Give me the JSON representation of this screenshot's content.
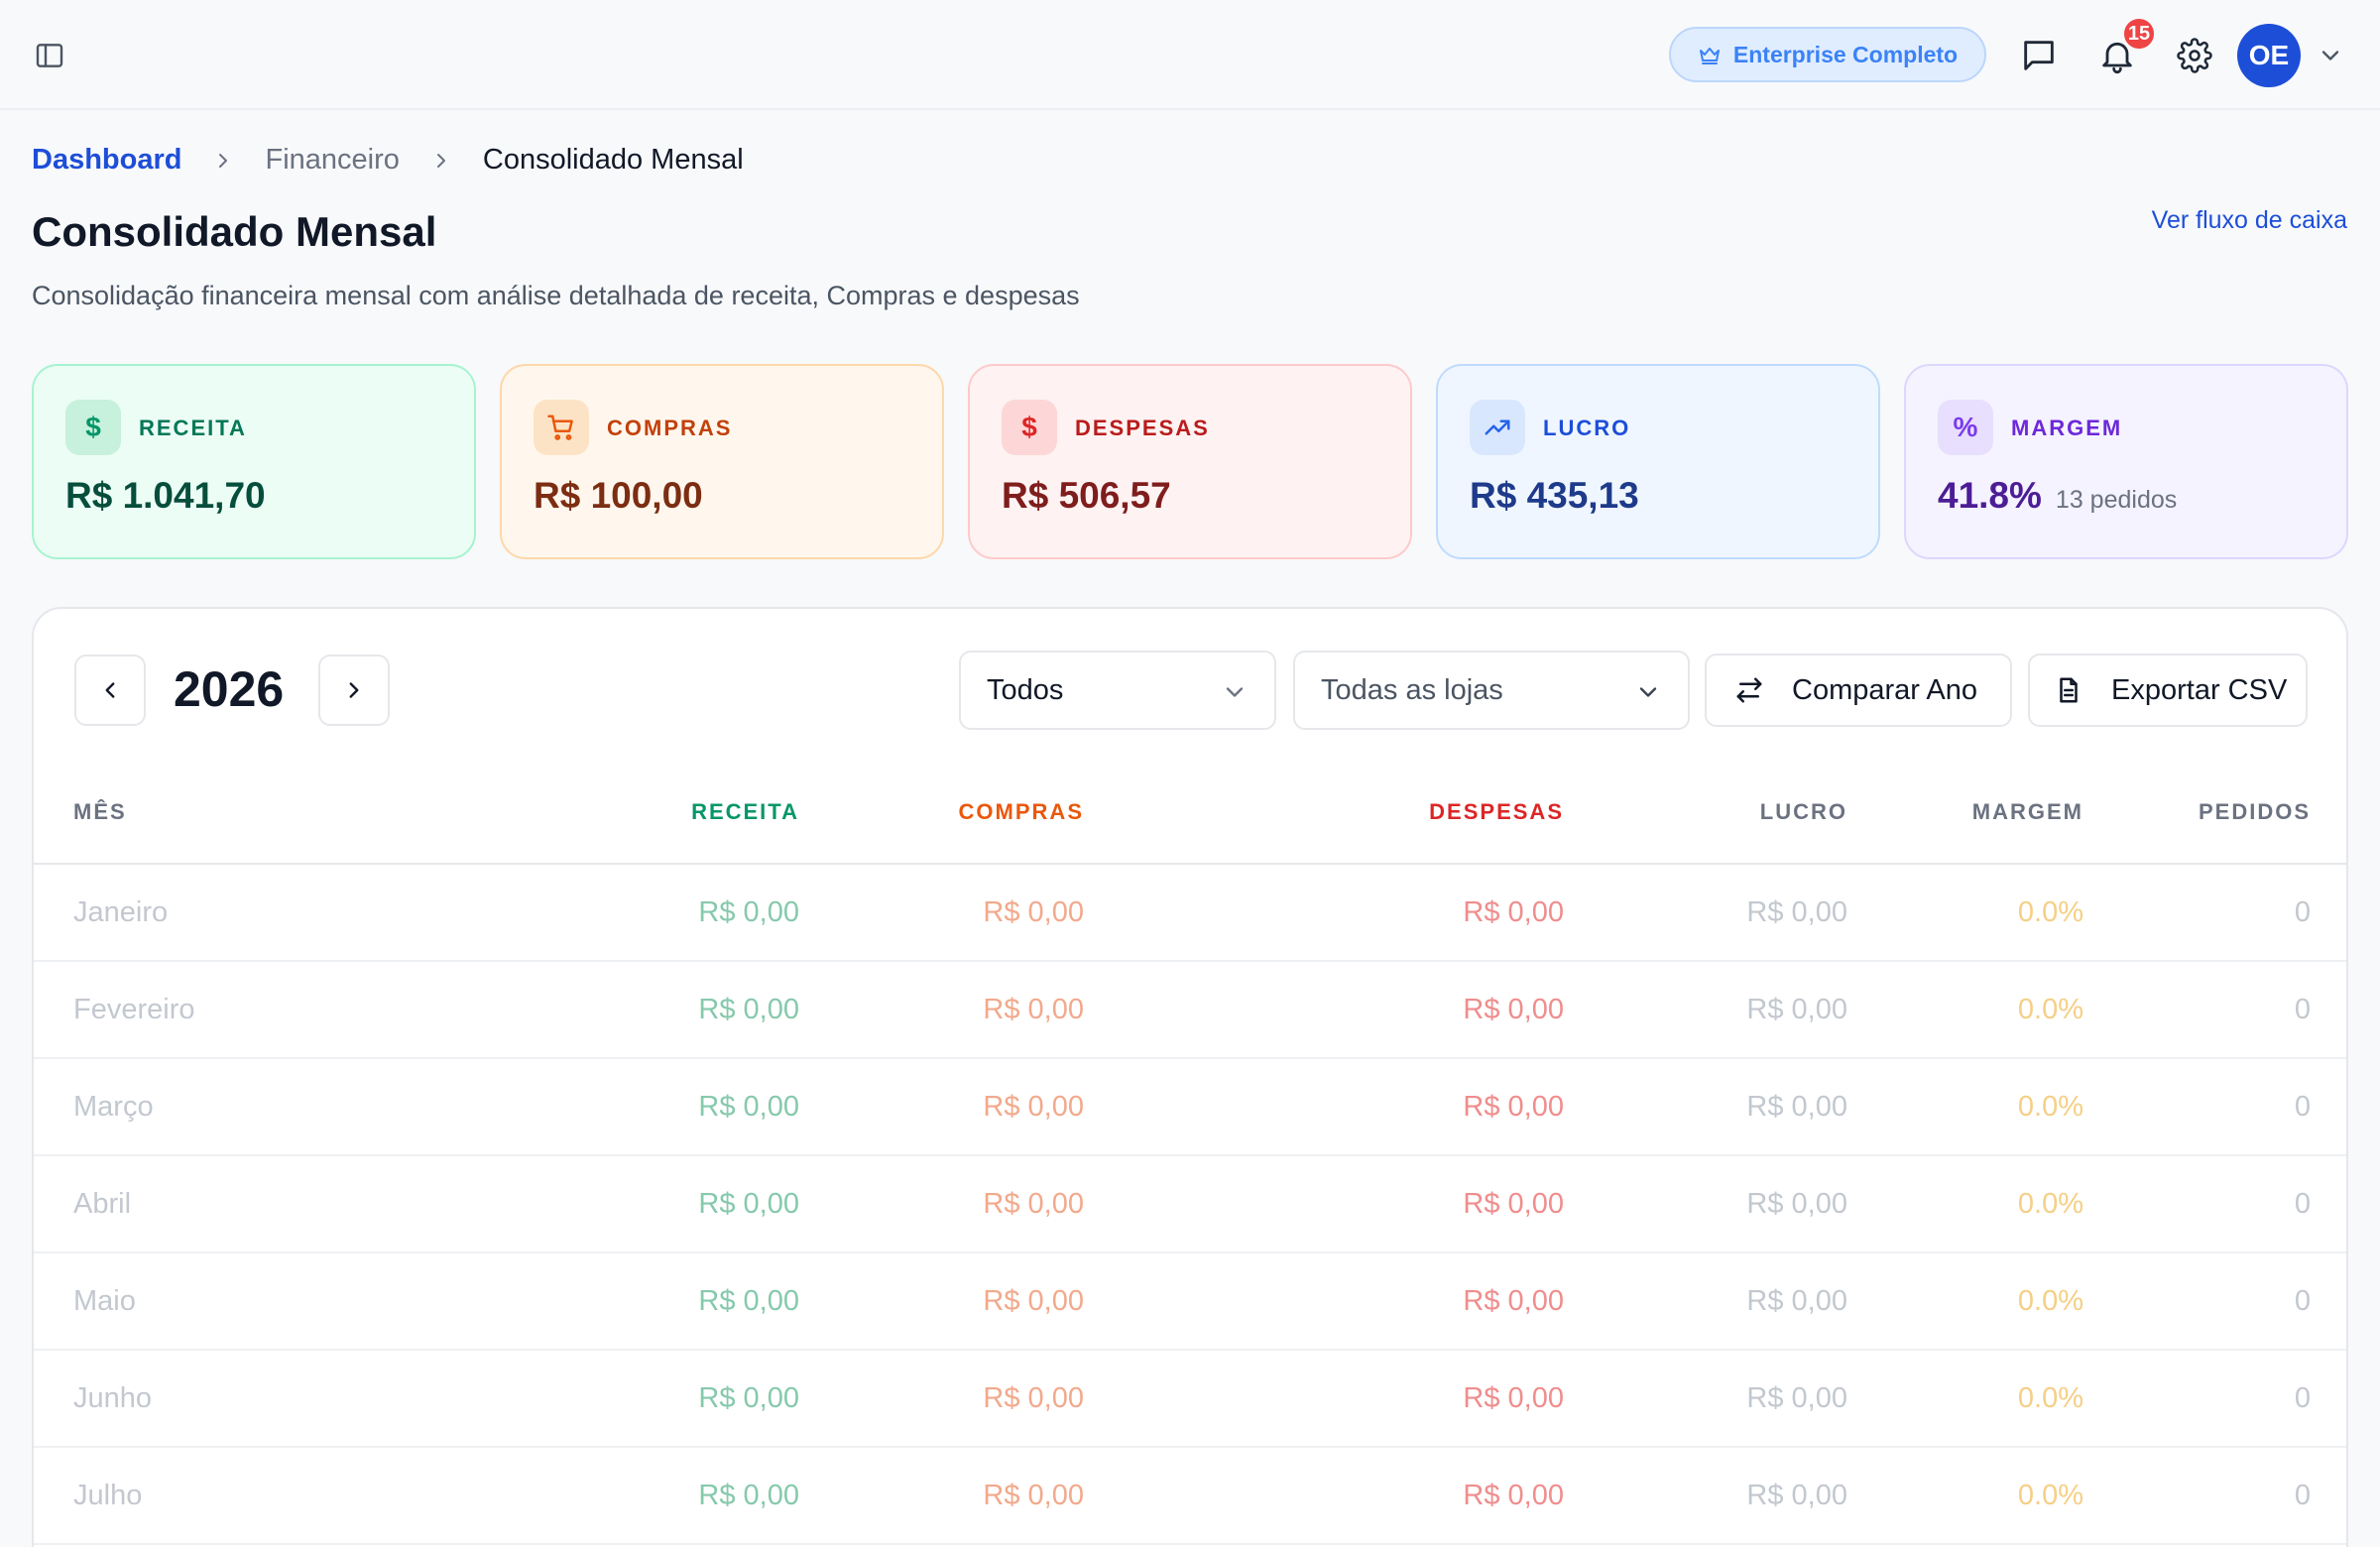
{
  "header": {
    "plan_badge": "Enterprise Completo",
    "notification_count": "15",
    "avatar_initials": "OE"
  },
  "breadcrumb": [
    "Dashboard",
    "Financeiro",
    "Consolidado Mensal"
  ],
  "page": {
    "title": "Consolidado Mensal",
    "subtitle": "Consolidação financeira mensal com análise detalhada de receita, Compras e despesas",
    "cashflow_link": "Ver fluxo de caixa"
  },
  "kpis": [
    {
      "label": "RECEITA",
      "value": "R$ 1.041,70",
      "icon": "dollar-icon",
      "color": "#059669"
    },
    {
      "label": "COMPRAS",
      "value": "R$ 100,00",
      "icon": "cart-icon",
      "color": "#ea580c"
    },
    {
      "label": "DESPESAS",
      "value": "R$ 506,57",
      "icon": "dollar-icon",
      "color": "#dc2626"
    },
    {
      "label": "LUCRO",
      "value": "R$ 435,13",
      "icon": "trending-up-icon",
      "color": "#2563eb"
    },
    {
      "label": "MARGEM",
      "value": "41.8%",
      "extra": "13 pedidos",
      "icon": "percent-icon",
      "color": "#7c3aed"
    }
  ],
  "toolbar": {
    "year": "2026",
    "type_filter": "Todos",
    "store_filter": "Todas as lojas",
    "compare_label": "Comparar Ano",
    "export_label": "Exportar CSV"
  },
  "table": {
    "headers": [
      "MÊS",
      "RECEITA",
      "COMPRAS",
      "DESPESAS",
      "LUCRO",
      "MARGEM",
      "PEDIDOS"
    ],
    "rows": [
      [
        "Janeiro",
        "R$ 0,00",
        "R$ 0,00",
        "R$ 0,00",
        "R$ 0,00",
        "0.0%",
        "0"
      ],
      [
        "Fevereiro",
        "R$ 0,00",
        "R$ 0,00",
        "R$ 0,00",
        "R$ 0,00",
        "0.0%",
        "0"
      ],
      [
        "Março",
        "R$ 0,00",
        "R$ 0,00",
        "R$ 0,00",
        "R$ 0,00",
        "0.0%",
        "0"
      ],
      [
        "Abril",
        "R$ 0,00",
        "R$ 0,00",
        "R$ 0,00",
        "R$ 0,00",
        "0.0%",
        "0"
      ],
      [
        "Maio",
        "R$ 0,00",
        "R$ 0,00",
        "R$ 0,00",
        "R$ 0,00",
        "0.0%",
        "0"
      ],
      [
        "Junho",
        "R$ 0,00",
        "R$ 0,00",
        "R$ 0,00",
        "R$ 0,00",
        "0.0%",
        "0"
      ],
      [
        "Julho",
        "R$ 0,00",
        "R$ 0,00",
        "R$ 0,00",
        "R$ 0,00",
        "0.0%",
        "0"
      ]
    ]
  }
}
